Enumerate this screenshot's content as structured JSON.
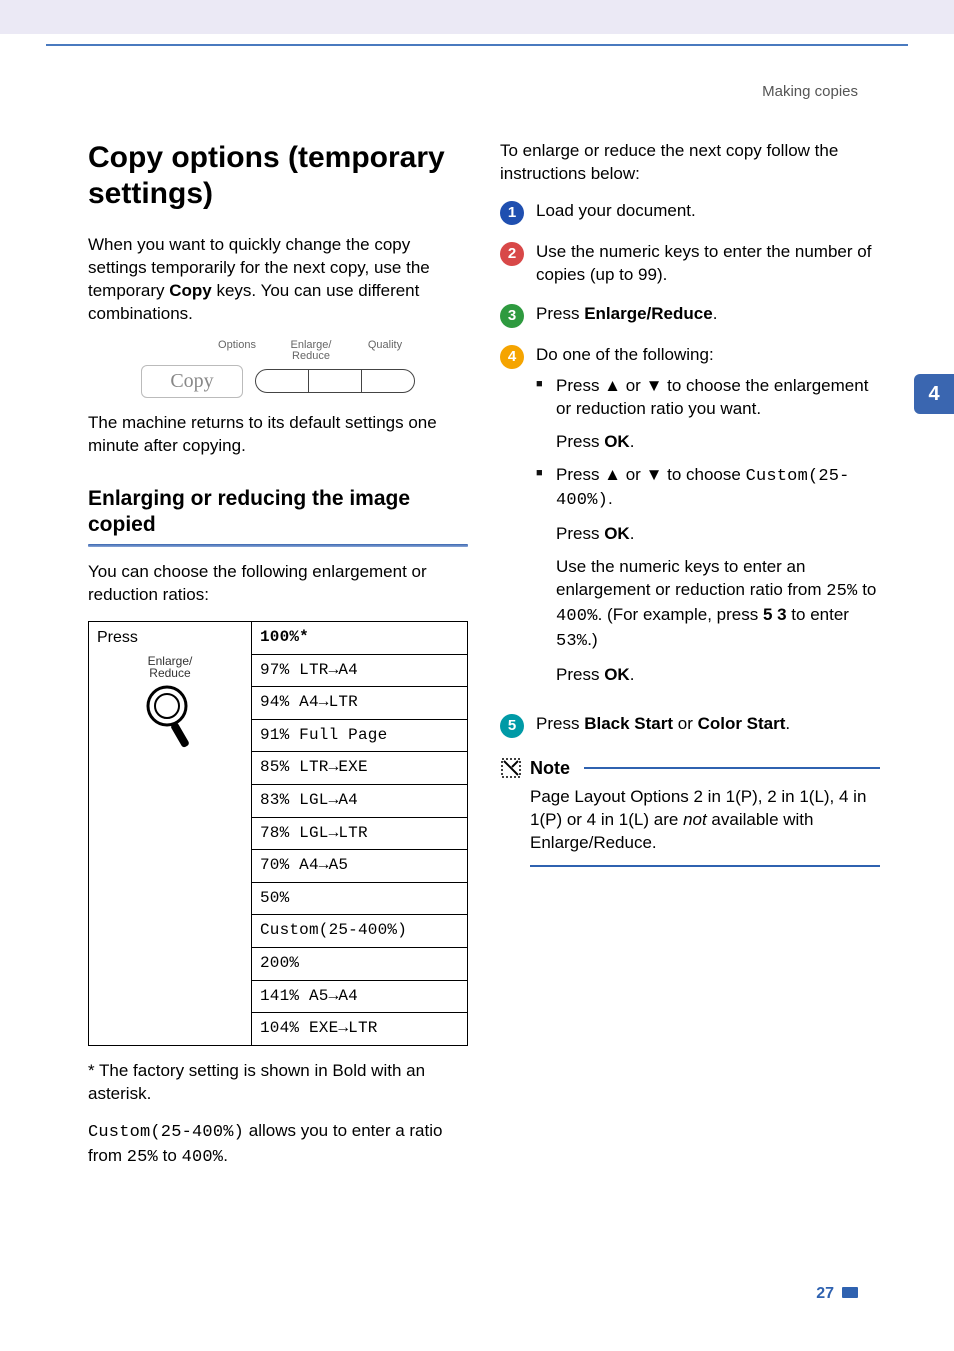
{
  "breadcrumb": "Making copies",
  "side_tab": "4",
  "page_number": "27",
  "left": {
    "h1": "Copy options (temporary settings)",
    "intro_a": "When you want to quickly change the copy settings temporarily for the next copy, use the temporary ",
    "intro_b_bold": "Copy",
    "intro_c": " keys. You can use different combinations.",
    "kbd_labels": {
      "opt": "Options",
      "enl": "Enlarge/\nReduce",
      "qual": "Quality"
    },
    "kbd_copy": "Copy",
    "after_fig": "The machine returns to its default settings one minute after copying.",
    "h2": "Enlarging or reducing the image copied",
    "ratios_intro": "You can choose the following enlargement or reduction ratios:",
    "table": {
      "press_label": "Press",
      "press_ill_label": "Enlarge/\nReduce",
      "header": "100%*",
      "rows": [
        "97% LTR→A4",
        "94% A4→LTR",
        "91% Full Page",
        "85% LTR→EXE",
        "83% LGL→A4",
        "78% LGL→LTR",
        "70% A4→A5",
        "50%",
        "Custom(25-400%)",
        "200%",
        "141% A5→A4",
        "104% EXE→LTR"
      ]
    },
    "footnote": "* The factory setting is shown in Bold with an asterisk.",
    "custom_a": "Custom(25-400%)",
    "custom_b": " allows you to enter a ratio from ",
    "custom_c": "25%",
    "custom_d": " to ",
    "custom_e": "400%",
    "custom_f": "."
  },
  "right": {
    "lead": "To enlarge or reduce the next copy follow the instructions below:",
    "steps": {
      "s1": "Load your document.",
      "s2": "Use the numeric keys to enter the number of copies (up to 99).",
      "s3_a": "Press ",
      "s3_b_bold": "Enlarge/Reduce",
      "s3_c": ".",
      "s4_lead": "Do one of the following:",
      "s4_opt1_a": "Press ▲ or ▼ to choose the enlargement or reduction ratio you want.",
      "s4_opt1_b_a": "Press ",
      "s4_opt1_b_bold": "OK",
      "s4_opt1_b_c": ".",
      "s4_opt2_a": "Press ▲ or ▼ to choose ",
      "s4_opt2_code": "Custom(25-400%)",
      "s4_opt2_a2": ".",
      "s4_opt2_b_a": "Press ",
      "s4_opt2_b_bold": "OK",
      "s4_opt2_b_c": ".",
      "s4_opt2_c_a": "Use the numeric keys to enter an enlargement or reduction ratio from ",
      "s4_opt2_c_code1": "25%",
      "s4_opt2_c_b": " to ",
      "s4_opt2_c_code2": "400%",
      "s4_opt2_c_c": ". (For example, press ",
      "s4_opt2_c_bold": "5 3",
      "s4_opt2_c_d": " to enter ",
      "s4_opt2_c_code3": "53%",
      "s4_opt2_c_e": ".)",
      "s4_opt2_d_a": "Press ",
      "s4_opt2_d_bold": "OK",
      "s4_opt2_d_c": ".",
      "s5_a": "Press ",
      "s5_bold1": "Black Start",
      "s5_b": " or ",
      "s5_bold2": "Color Start",
      "s5_c": "."
    },
    "note_label": "Note",
    "note_a": "Page Layout Options 2 in 1(P), 2 in 1(L), 4 in 1(P) or 4 in 1(L) are ",
    "note_it": "not",
    "note_b": " available with Enlarge/Reduce."
  }
}
